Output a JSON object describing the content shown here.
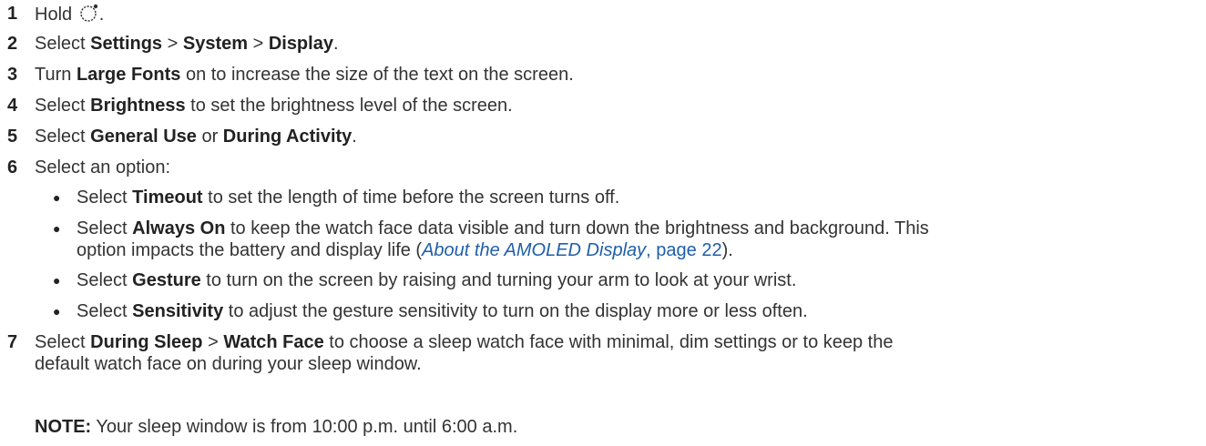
{
  "steps": [
    {
      "num": "1",
      "pre": "Hold ",
      "icon": "watch-button-icon",
      "post": "."
    },
    {
      "num": "2",
      "pre": "Select ",
      "b1": "Settings",
      "mid1": " > ",
      "b2": "System",
      "mid2": " > ",
      "b3": "Display",
      "post": "."
    },
    {
      "num": "3",
      "pre": "Turn ",
      "b1": "Large Fonts",
      "post": " on to increase the size of the text on the screen."
    },
    {
      "num": "4",
      "pre": "Select ",
      "b1": "Brightness",
      "post": " to set the brightness level of the screen."
    },
    {
      "num": "5",
      "pre": "Select ",
      "b1": "General Use",
      "mid1": " or ",
      "b2": "During Activity",
      "post": "."
    },
    {
      "num": "6",
      "text": "Select an option:"
    },
    {
      "num": "7",
      "pre": "Select ",
      "b1": "During Sleep",
      "mid1": " > ",
      "b2": "Watch Face",
      "post": " to choose a sleep watch face with minimal, dim settings or to keep the",
      "cont": "default watch face on during your sleep window."
    }
  ],
  "bullets": [
    {
      "pre": "Select ",
      "b": "Timeout",
      "post": " to set the length of time before the screen turns off."
    },
    {
      "pre": "Select ",
      "b": "Always On",
      "post": " to keep the watch face data visible and turn down the brightness and background. This",
      "cont_pre": "option impacts the battery and display life (",
      "xref": "About the AMOLED Display",
      "xref_sep": ", ",
      "xref_page": "page 22",
      "cont_post": ")."
    },
    {
      "pre": "Select ",
      "b": "Gesture",
      "post": " to turn on the screen by raising and turning your arm to look at your wrist."
    },
    {
      "pre": "Select ",
      "b": "Sensitivity",
      "post": " to adjust the gesture sensitivity to turn on the display more or less often."
    }
  ],
  "note": {
    "label": "NOTE:",
    "text": " Your sleep window is from 10:00 p.m. until 6:00 a.m."
  },
  "colors": {
    "text": "#333333",
    "link": "#1f5fa8"
  }
}
